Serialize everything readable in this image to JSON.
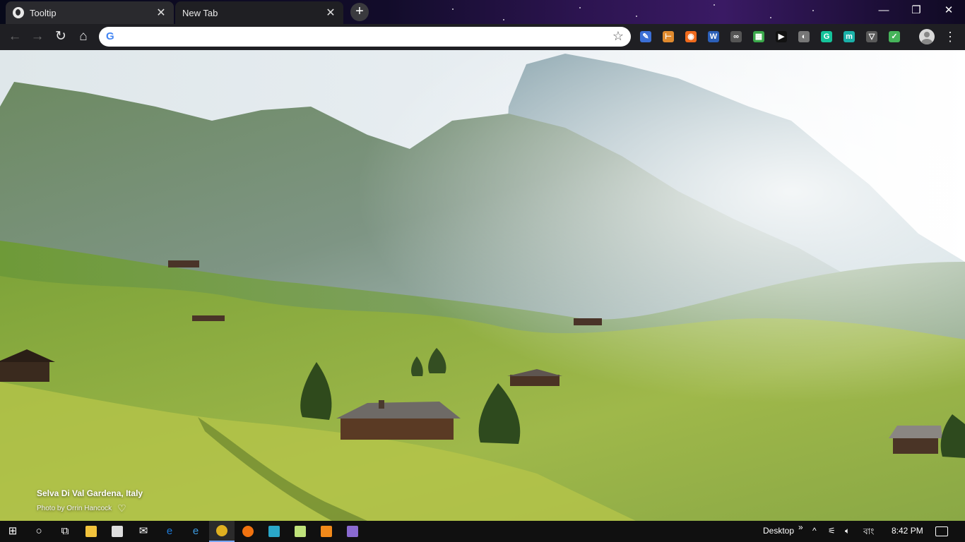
{
  "tabs": [
    {
      "title": "Tooltip",
      "icon": "globe-icon"
    },
    {
      "title": "New Tab",
      "icon": ""
    }
  ],
  "window_controls": {
    "minimize": "—",
    "restore": "❐",
    "close": "✕"
  },
  "toolbar": {
    "back": "←",
    "forward": "→",
    "reload": "↻",
    "home": "⌂",
    "omnibox_value": "",
    "omnibox_placeholder": "",
    "google_glyph": "G",
    "bookmark_star": "☆",
    "menu": "⋮"
  },
  "extensions": [
    {
      "name": "pen-extension-icon",
      "glyph": "✎",
      "color": "#3b6fd6"
    },
    {
      "name": "measure-extension-icon",
      "glyph": "⊢",
      "color": "#e08a2e"
    },
    {
      "name": "orange-extension-icon",
      "glyph": "◉",
      "color": "#f06a1c"
    },
    {
      "name": "word-extension-icon",
      "glyph": "W",
      "color": "#2b5fb8"
    },
    {
      "name": "binocular-extension-icon",
      "glyph": "∞",
      "color": "#555555"
    },
    {
      "name": "color-palette-extension-icon",
      "glyph": "▦",
      "color": "#3aa84a"
    },
    {
      "name": "play-extension-icon",
      "glyph": "▶",
      "color": "#111111"
    },
    {
      "name": "circle-extension-icon",
      "glyph": "◐",
      "color": "#777777"
    },
    {
      "name": "grammarly-extension-icon",
      "glyph": "G",
      "color": "#15c39a"
    },
    {
      "name": "m-extension-icon",
      "glyph": "m",
      "color": "#1ab0a8"
    },
    {
      "name": "pocket-extension-icon",
      "glyph": "▽",
      "color": "#5a5a5a"
    },
    {
      "name": "check-extension-icon",
      "glyph": "✓",
      "color": "#46b45a"
    }
  ],
  "photo": {
    "location": "Selva Di Val Gardena, Italy",
    "photographer": "Photo by Orrin Hancock",
    "heart": "♡"
  },
  "taskbar": {
    "apps": [
      {
        "name": "start-button",
        "color": "#ffffff"
      },
      {
        "name": "cortana-search-button",
        "color": "#ffffff"
      },
      {
        "name": "task-view-button",
        "color": "#ffffff"
      },
      {
        "name": "file-explorer-taskbar-icon",
        "color": "#f2c33c"
      },
      {
        "name": "store-taskbar-icon",
        "color": "#dddddd"
      },
      {
        "name": "mail-taskbar-icon",
        "color": "#ffffff"
      },
      {
        "name": "edge-taskbar-icon",
        "color": "#1e7ad6"
      },
      {
        "name": "internet-explorer-taskbar-icon",
        "color": "#3c9be0"
      },
      {
        "name": "chrome-taskbar-icon",
        "color": "#e0b020"
      },
      {
        "name": "firefox-taskbar-icon",
        "color": "#f0720f"
      },
      {
        "name": "app-taskbar-icon",
        "color": "#2aa7c9"
      },
      {
        "name": "notepad-taskbar-icon",
        "color": "#bfe27a"
      },
      {
        "name": "sublime-taskbar-icon",
        "color": "#f28a1a"
      },
      {
        "name": "visual-studio-taskbar-icon",
        "color": "#8a6ad0"
      }
    ],
    "desktop_label": "Desktop",
    "overflow": "»",
    "up_chevron": "^",
    "language": "বাং",
    "time": "8:42 PM"
  }
}
